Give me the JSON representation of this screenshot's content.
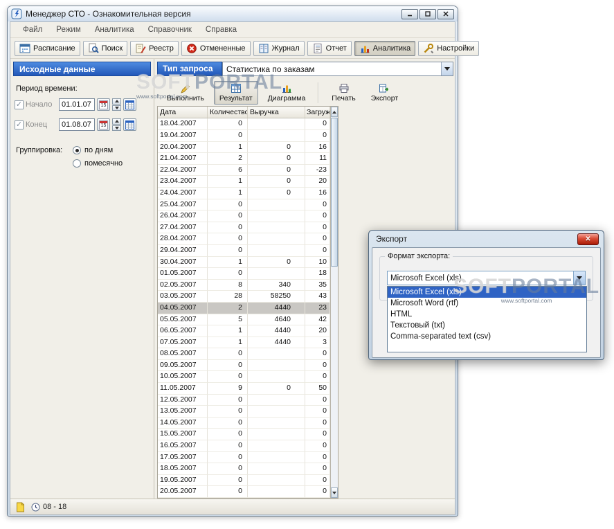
{
  "window": {
    "title": "Менеджер СТО - Ознакомительная версия"
  },
  "menu": {
    "items": [
      "Файл",
      "Режим",
      "Аналитика",
      "Справочник",
      "Справка"
    ]
  },
  "toolbar": {
    "items": [
      {
        "label": "Расписание",
        "icon": "schedule-icon"
      },
      {
        "label": "Поиск",
        "icon": "search-icon"
      },
      {
        "label": "Реестр",
        "icon": "register-icon"
      },
      {
        "label": "Отмененные",
        "icon": "cancelled-icon"
      },
      {
        "label": "Журнал",
        "icon": "journal-icon"
      },
      {
        "label": "Отчет",
        "icon": "report-icon"
      },
      {
        "label": "Аналитика",
        "icon": "analytics-icon",
        "active": true
      },
      {
        "label": "Настройки",
        "icon": "settings-icon"
      }
    ]
  },
  "sidebar": {
    "header": "Исходные данные",
    "period_label": "Период времени:",
    "start": {
      "label": "Начало",
      "value": "01.01.07",
      "checked": true
    },
    "end": {
      "label": "Конец",
      "value": "01.08.07",
      "checked": true
    },
    "calendar_button_day": "15",
    "grouping_label": "Группировка:",
    "grouping_options": [
      {
        "label": "по дням",
        "selected": true
      },
      {
        "label": "помесячно",
        "selected": false
      }
    ]
  },
  "query": {
    "type_label": "Тип запроса",
    "type_value": "Статистика по заказам",
    "buttons": [
      {
        "label": "Выполнить"
      },
      {
        "label": "Результат",
        "active": true
      },
      {
        "label": "Диаграмма"
      },
      {
        "label": "Печать"
      },
      {
        "label": "Экспорт"
      }
    ]
  },
  "table": {
    "columns": [
      "Дата",
      "Количество",
      "Выручка",
      "Загружен..."
    ],
    "rows": [
      {
        "date": "18.04.2007",
        "qty": "0",
        "revenue": "",
        "load": "0"
      },
      {
        "date": "19.04.2007",
        "qty": "0",
        "revenue": "",
        "load": "0"
      },
      {
        "date": "20.04.2007",
        "qty": "1",
        "revenue": "0",
        "load": "16"
      },
      {
        "date": "21.04.2007",
        "qty": "2",
        "revenue": "0",
        "load": "11"
      },
      {
        "date": "22.04.2007",
        "qty": "6",
        "revenue": "0",
        "load": "-23"
      },
      {
        "date": "23.04.2007",
        "qty": "1",
        "revenue": "0",
        "load": "20"
      },
      {
        "date": "24.04.2007",
        "qty": "1",
        "revenue": "0",
        "load": "16"
      },
      {
        "date": "25.04.2007",
        "qty": "0",
        "revenue": "",
        "load": "0"
      },
      {
        "date": "26.04.2007",
        "qty": "0",
        "revenue": "",
        "load": "0"
      },
      {
        "date": "27.04.2007",
        "qty": "0",
        "revenue": "",
        "load": "0"
      },
      {
        "date": "28.04.2007",
        "qty": "0",
        "revenue": "",
        "load": "0"
      },
      {
        "date": "29.04.2007",
        "qty": "0",
        "revenue": "",
        "load": "0"
      },
      {
        "date": "30.04.2007",
        "qty": "1",
        "revenue": "0",
        "load": "10"
      },
      {
        "date": "01.05.2007",
        "qty": "0",
        "revenue": "",
        "load": "18"
      },
      {
        "date": "02.05.2007",
        "qty": "8",
        "revenue": "340",
        "load": "35"
      },
      {
        "date": "03.05.2007",
        "qty": "28",
        "revenue": "58250",
        "load": "43"
      },
      {
        "date": "04.05.2007",
        "qty": "2",
        "revenue": "4440",
        "load": "23",
        "selected": true
      },
      {
        "date": "05.05.2007",
        "qty": "5",
        "revenue": "4640",
        "load": "42"
      },
      {
        "date": "06.05.2007",
        "qty": "1",
        "revenue": "4440",
        "load": "20"
      },
      {
        "date": "07.05.2007",
        "qty": "1",
        "revenue": "4440",
        "load": "3"
      },
      {
        "date": "08.05.2007",
        "qty": "0",
        "revenue": "",
        "load": "0"
      },
      {
        "date": "09.05.2007",
        "qty": "0",
        "revenue": "",
        "load": "0"
      },
      {
        "date": "10.05.2007",
        "qty": "0",
        "revenue": "",
        "load": "0"
      },
      {
        "date": "11.05.2007",
        "qty": "9",
        "revenue": "0",
        "load": "50"
      },
      {
        "date": "12.05.2007",
        "qty": "0",
        "revenue": "",
        "load": "0"
      },
      {
        "date": "13.05.2007",
        "qty": "0",
        "revenue": "",
        "load": "0"
      },
      {
        "date": "14.05.2007",
        "qty": "0",
        "revenue": "",
        "load": "0"
      },
      {
        "date": "15.05.2007",
        "qty": "0",
        "revenue": "",
        "load": "0"
      },
      {
        "date": "16.05.2007",
        "qty": "0",
        "revenue": "",
        "load": "0"
      },
      {
        "date": "17.05.2007",
        "qty": "0",
        "revenue": "",
        "load": "0"
      },
      {
        "date": "18.05.2007",
        "qty": "0",
        "revenue": "",
        "load": "0"
      },
      {
        "date": "19.05.2007",
        "qty": "0",
        "revenue": "",
        "load": "0"
      },
      {
        "date": "20.05.2007",
        "qty": "0",
        "revenue": "",
        "load": "0"
      }
    ]
  },
  "export_dialog": {
    "title": "Экспорт",
    "format_label": "Формат экспорта:",
    "combo_value": "Microsoft Excel (xls)",
    "options": [
      {
        "label": "Microsoft Excel (xls)",
        "selected": true
      },
      {
        "label": "Microsoft Word (rtf)"
      },
      {
        "label": "HTML"
      },
      {
        "label": "Текстовый (txt)"
      },
      {
        "label": "Comma-separated text (csv)"
      }
    ]
  },
  "statusbar": {
    "time_range": "08 - 18"
  },
  "watermark": {
    "left": "SOFT",
    "right": "PORTAL",
    "url": "www.softportal.com"
  },
  "icons": {
    "minimize": "—",
    "maximize": "□",
    "close": "✕",
    "checkbox_check": "✓",
    "combo_arrow": "▼"
  }
}
